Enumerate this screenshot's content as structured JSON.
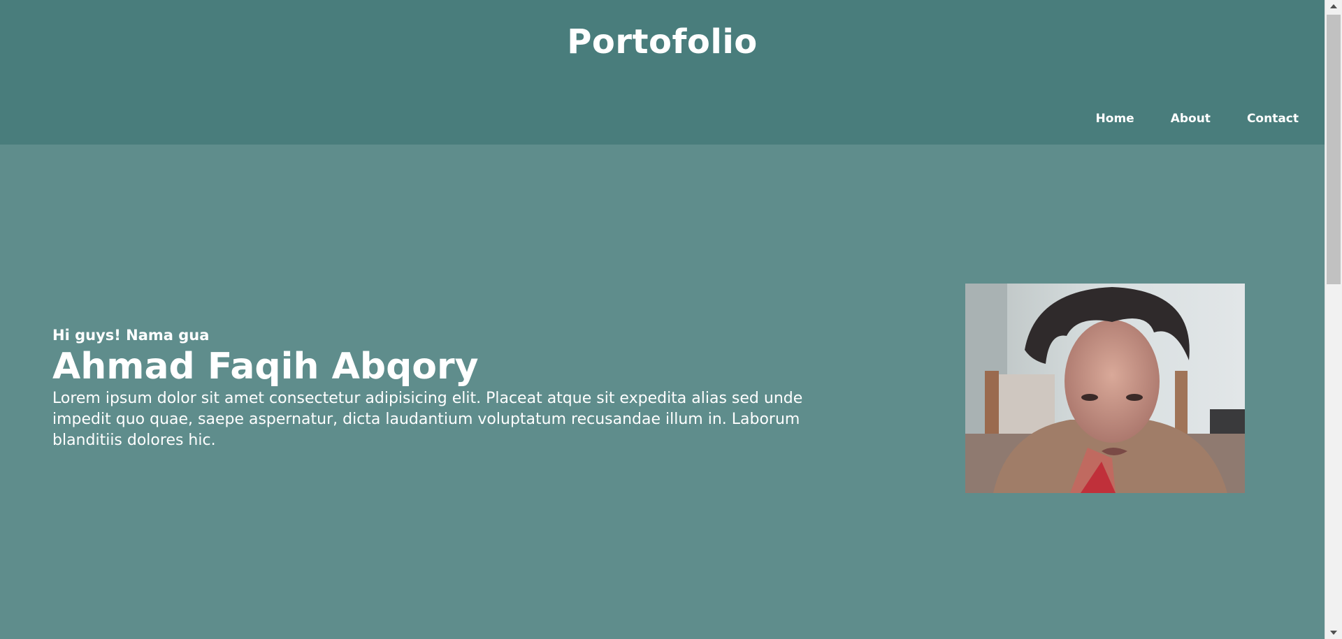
{
  "header": {
    "title": "Portofolio"
  },
  "nav": {
    "items": [
      {
        "label": "Home"
      },
      {
        "label": "About"
      },
      {
        "label": "Contact"
      }
    ]
  },
  "hero": {
    "greeting": "Hi guys! Nama gua",
    "name": "Ahmad Faqih Abqory",
    "bio": "Lorem ipsum dolor sit amet consectetur adipisicing elit. Placeat atque sit expedita alias sed unde impedit quo quae, saepe aspernatur, dicta laudantium voluptatum recusandae illum in. Laborum blanditiis dolores hic."
  },
  "colors": {
    "header_bg": "#497d7c",
    "page_bg": "#5f8d8c",
    "text": "#ffffff"
  }
}
